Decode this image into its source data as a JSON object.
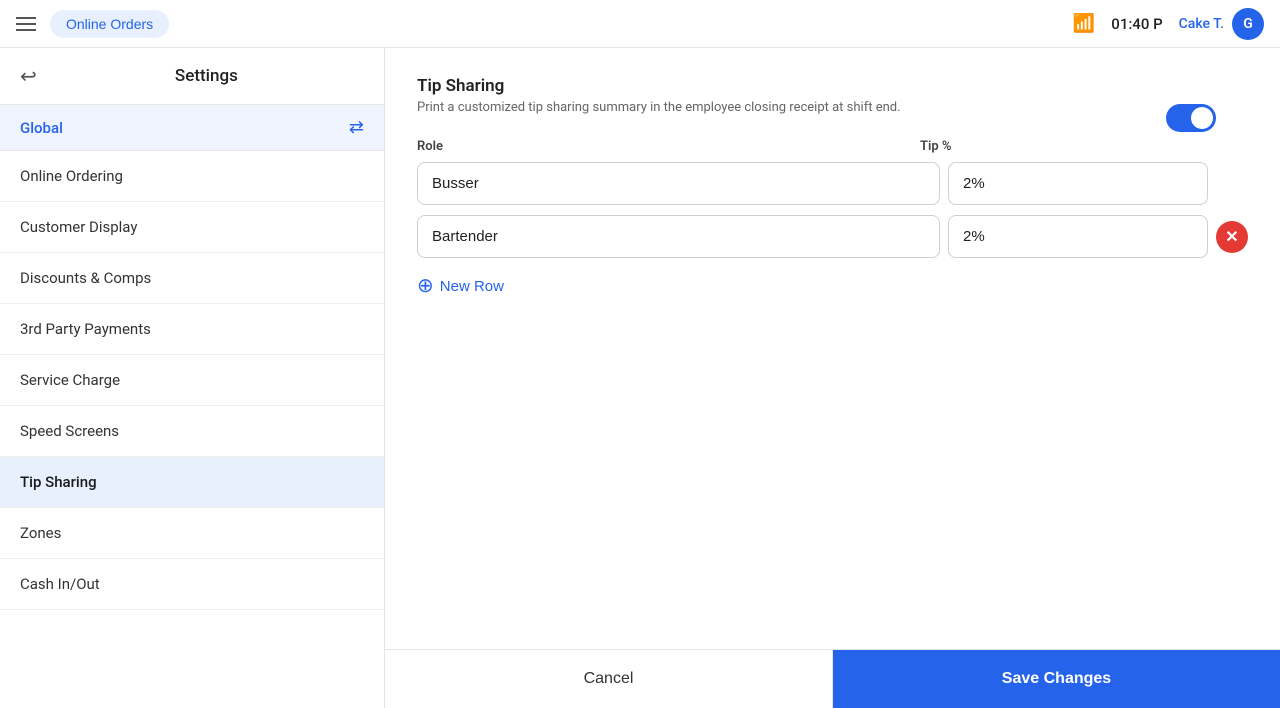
{
  "topbar": {
    "app_label": "Online Orders",
    "time": "01:40 P",
    "user_name": "Cake T.",
    "user_initials": "G"
  },
  "sidebar": {
    "title": "Settings",
    "global_label": "Global",
    "nav_items": [
      {
        "id": "online-ordering",
        "label": "Online Ordering",
        "active": false
      },
      {
        "id": "customer-display",
        "label": "Customer Display",
        "active": false
      },
      {
        "id": "discounts-comps",
        "label": "Discounts & Comps",
        "active": false
      },
      {
        "id": "3rd-party-payments",
        "label": "3rd Party Payments",
        "active": false
      },
      {
        "id": "service-charge",
        "label": "Service Charge",
        "active": false
      },
      {
        "id": "speed-screens",
        "label": "Speed Screens",
        "active": false
      },
      {
        "id": "tip-sharing",
        "label": "Tip Sharing",
        "active": true
      },
      {
        "id": "zones",
        "label": "Zones",
        "active": false
      },
      {
        "id": "cash-in-out",
        "label": "Cash In/Out",
        "active": false
      }
    ]
  },
  "content": {
    "section_title": "Tip Sharing",
    "section_desc": "Print a customized tip sharing summary in the employee closing receipt at shift end.",
    "toggle_on": true,
    "col_role": "Role",
    "col_tip": "Tip %",
    "rows": [
      {
        "role": "Busser",
        "tip": "2%",
        "deletable": false
      },
      {
        "role": "Bartender",
        "tip": "2%",
        "deletable": true
      }
    ],
    "new_row_label": "New Row"
  },
  "footer": {
    "cancel_label": "Cancel",
    "save_label": "Save Changes"
  }
}
